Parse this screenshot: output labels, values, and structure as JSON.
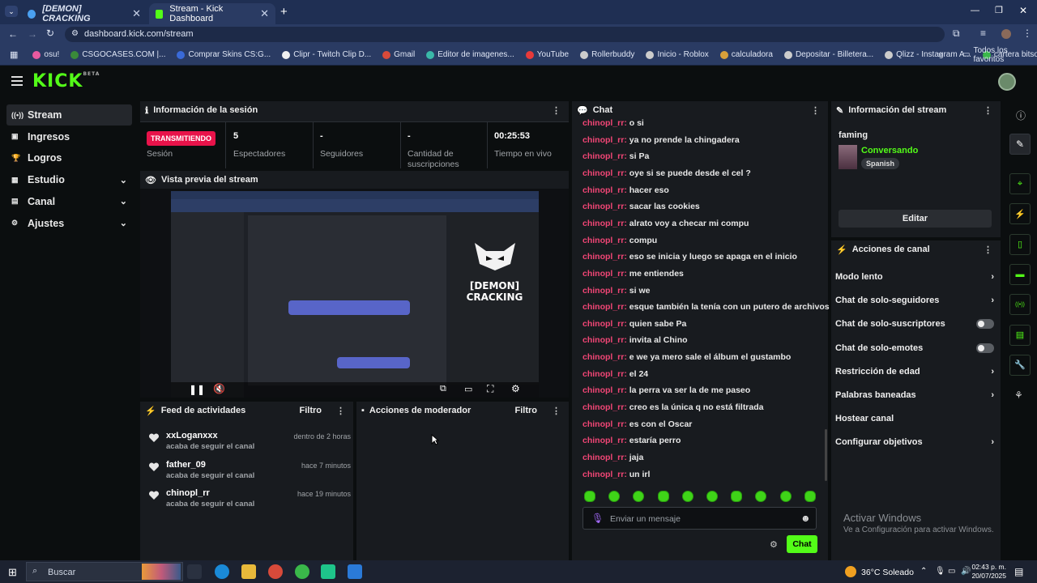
{
  "browser": {
    "tabs": [
      {
        "label": "[DEMON] CRACKING",
        "active": false
      },
      {
        "label": "Stream - Kick Dashboard",
        "active": true
      }
    ],
    "url": "dashboard.kick.com/stream",
    "bookmarks": [
      "osu!",
      "CSGOCASES.COM |...",
      "Comprar Skins CS:G...",
      "Clipr - Twitch Clip D...",
      "Gmail",
      "Editor de imagenes...",
      "YouTube",
      "Rollerbuddy",
      "Inicio - Roblox",
      "calculadora",
      "Depositar - Billetera...",
      "Qlizz - Instagram A...",
      "cartera bitso"
    ],
    "bookmarks_all": "Todos los favoritos"
  },
  "kick": {
    "logo": "KICK",
    "logo_badge": "BETA"
  },
  "sidebar": {
    "items": [
      {
        "label": "Stream",
        "icon": "broadcast-icon",
        "active": true,
        "chevron": false
      },
      {
        "label": "Ingresos",
        "icon": "wallet-icon",
        "active": false,
        "chevron": false
      },
      {
        "label": "Logros",
        "icon": "trophy-icon",
        "active": false,
        "chevron": false
      },
      {
        "label": "Estudio",
        "icon": "studio-icon",
        "active": false,
        "chevron": true
      },
      {
        "label": "Canal",
        "icon": "channel-icon",
        "active": false,
        "chevron": true
      },
      {
        "label": "Ajustes",
        "icon": "gear-icon",
        "active": false,
        "chevron": true
      }
    ]
  },
  "session": {
    "title": "Información de la sesión",
    "status_badge": "TRANSMITIENDO",
    "status_label": "Sesión",
    "stats": [
      {
        "value": "5",
        "label": "Espectadores"
      },
      {
        "value": "-",
        "label": "Seguidores"
      },
      {
        "value": "-",
        "label": "Cantidad de suscripciones"
      },
      {
        "value": "00:25:53",
        "label": "Tiempo en vivo"
      }
    ]
  },
  "preview": {
    "title": "Vista previa del stream",
    "server_name": "[DEMON] CRACKING",
    "server_sub": "[DEMON] CRACKING"
  },
  "feed": {
    "title": "Feed de actividades",
    "filter": "Filtro",
    "items": [
      {
        "user": "xxLoganxxx",
        "action": "acaba de seguir el canal",
        "time": "dentro de 2 horas"
      },
      {
        "user": "father_09",
        "action": "acaba de seguir el canal",
        "time": "hace 7 minutos"
      },
      {
        "user": "chinopl_rr",
        "action": "acaba de seguir el canal",
        "time": "hace 19 minutos"
      }
    ]
  },
  "mod": {
    "title": "Acciones de moderador",
    "filter": "Filtro"
  },
  "chat": {
    "title": "Chat",
    "messages": [
      {
        "user": "chinopl_rr:",
        "text": "o si"
      },
      {
        "user": "chinopl_rr:",
        "text": "ya no prende la chingadera"
      },
      {
        "user": "chinopl_rr:",
        "text": "si Pa"
      },
      {
        "user": "chinopl_rr:",
        "text": "oye si se puede desde el cel ?"
      },
      {
        "user": "chinopl_rr:",
        "text": "hacer eso"
      },
      {
        "user": "chinopl_rr:",
        "text": "sacar las cookies"
      },
      {
        "user": "chinopl_rr:",
        "text": "alrato voy a checar mi compu"
      },
      {
        "user": "chinopl_rr:",
        "text": "compu"
      },
      {
        "user": "chinopl_rr:",
        "text": "eso se inicia y luego se apaga en el inicio"
      },
      {
        "user": "chinopl_rr:",
        "text": "me entiendes"
      },
      {
        "user": "chinopl_rr:",
        "text": "si we"
      },
      {
        "user": "chinopl_rr:",
        "text": "esque también la tenía con un putero de archivos"
      },
      {
        "user": "chinopl_rr:",
        "text": "quien sabe Pa"
      },
      {
        "user": "chinopl_rr:",
        "text": "invita al Chino"
      },
      {
        "user": "chinopl_rr:",
        "text": "e we ya mero sale el álbum el gustambo"
      },
      {
        "user": "chinopl_rr:",
        "text": "el 24"
      },
      {
        "user": "chinopl_rr:",
        "text": "la perra va ser la de me paseo"
      },
      {
        "user": "chinopl_rr:",
        "text": "creo es la única q no está filtrada"
      },
      {
        "user": "chinopl_rr:",
        "text": "es con el Oscar"
      },
      {
        "user": "chinopl_rr:",
        "text": "estaría perro"
      },
      {
        "user": "chinopl_rr:",
        "text": "jaja"
      },
      {
        "user": "chinopl_rr:",
        "text": "un irl"
      }
    ],
    "input_placeholder": "Enviar un mensaje",
    "send_label": "Chat"
  },
  "stream_info": {
    "title": "Información del stream",
    "stream_title": "faming",
    "category": "Conversando",
    "language": "Spanish",
    "edit_label": "Editar"
  },
  "channel_actions": {
    "title": "Acciones de canal",
    "items": [
      {
        "label": "Modo lento",
        "control": "chevron"
      },
      {
        "label": "Chat de solo-seguidores",
        "control": "chevron"
      },
      {
        "label": "Chat de solo-suscriptores",
        "control": "toggle"
      },
      {
        "label": "Chat de solo-emotes",
        "control": "toggle"
      },
      {
        "label": "Restricción de edad",
        "control": "chevron"
      },
      {
        "label": "Palabras baneadas",
        "control": "chevron"
      },
      {
        "label": "Hostear canal",
        "control": "none"
      },
      {
        "label": "Configurar objetivos",
        "control": "chevron"
      }
    ]
  },
  "watermark": {
    "title": "Activar Windows",
    "sub": "Ve a Configuración para activar Windows."
  },
  "taskbar": {
    "search": "Buscar",
    "weather": "36°C Soleado",
    "time": "02:43 p. m.",
    "date": "20/07/2025"
  },
  "colors": {
    "accent": "#53fc18",
    "live": "#e8134a",
    "chat_user": "#f24676"
  }
}
